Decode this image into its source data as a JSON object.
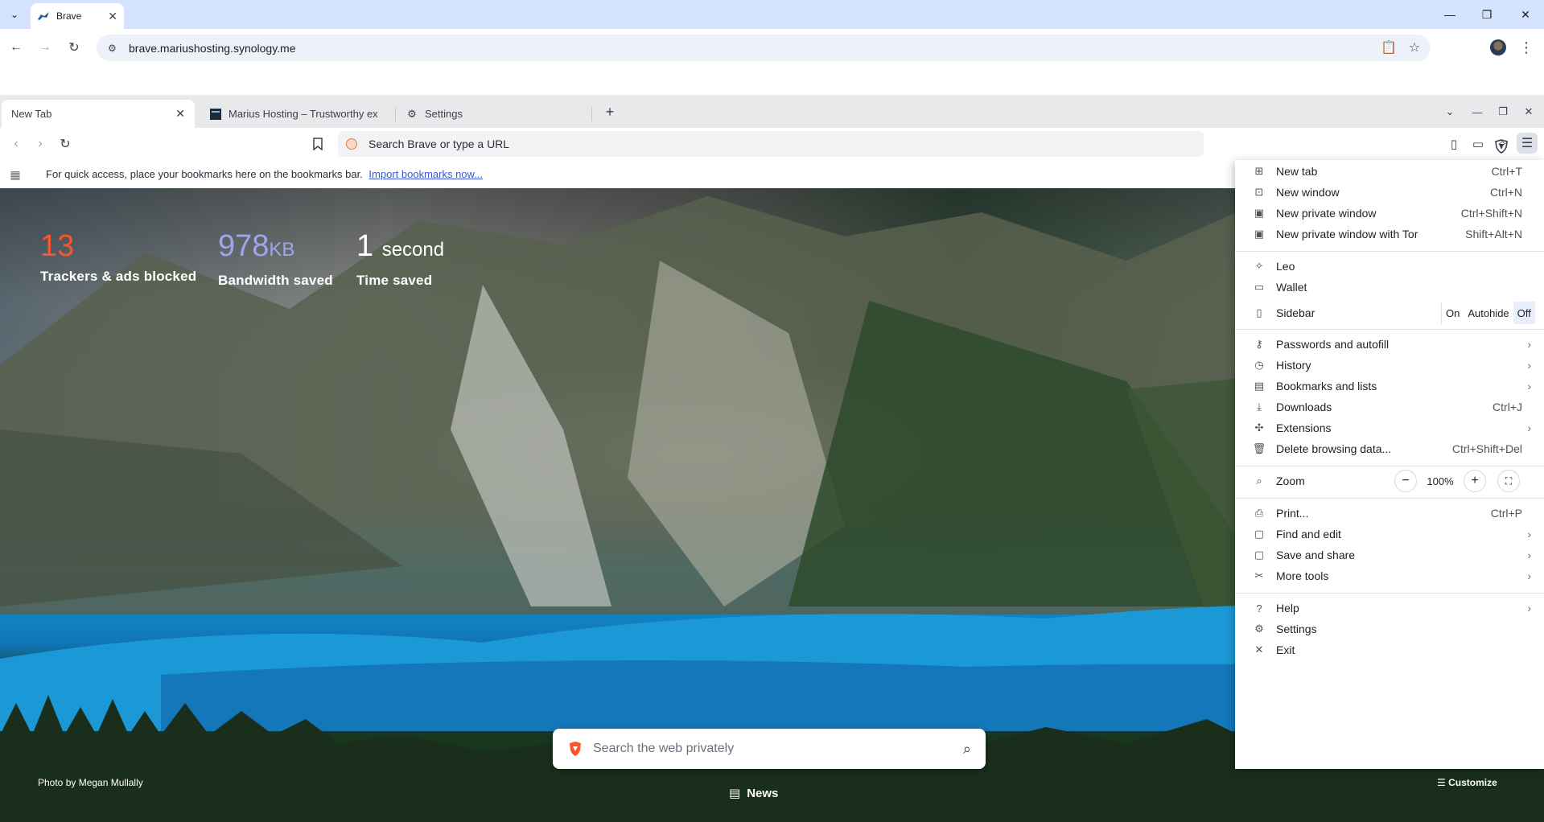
{
  "host": {
    "tab_title": "Brave",
    "url": "brave.mariushosting.synology.me"
  },
  "brave": {
    "tabs": [
      {
        "label": "New Tab",
        "active": true
      },
      {
        "label": "Marius Hosting – Trustworthy ex",
        "active": false
      },
      {
        "label": "Settings",
        "active": false
      }
    ],
    "omnibox_placeholder": "Search Brave or type a URL",
    "bookmarks_bar": {
      "message": "For quick access, place your bookmarks here on the bookmarks bar.",
      "import_link": "Import bookmarks now..."
    }
  },
  "ntp": {
    "stats": [
      {
        "value": "13",
        "unit": "",
        "label": "Trackers & ads blocked",
        "color": "#fb542b"
      },
      {
        "value": "978",
        "unit": "KB",
        "label": "Bandwidth saved",
        "color": "#a0a5eb"
      },
      {
        "value": "1",
        "unit": "second",
        "label": "Time saved",
        "color": "#ffffff"
      }
    ],
    "search_placeholder": "Search the web privately",
    "photo_credit": "Photo by Megan Mullally",
    "news_label": "News",
    "customize_label": "Customize"
  },
  "menu": {
    "items": [
      {
        "id": "new-tab",
        "label": "New tab",
        "shortcut": "Ctrl+T",
        "icon": "new-tab-icon"
      },
      {
        "id": "new-window",
        "label": "New window",
        "shortcut": "Ctrl+N",
        "icon": "new-window-icon"
      },
      {
        "id": "new-private-window",
        "label": "New private window",
        "shortcut": "Ctrl+Shift+N",
        "icon": "private-window-icon"
      },
      {
        "id": "new-private-window-tor",
        "label": "New private window with Tor",
        "shortcut": "Shift+Alt+N",
        "icon": "tor-window-icon"
      },
      {
        "id": "leo",
        "label": "Leo",
        "shortcut": "",
        "icon": "leo-icon"
      },
      {
        "id": "wallet",
        "label": "Wallet",
        "shortcut": "",
        "icon": "wallet-icon"
      },
      {
        "id": "sidebar",
        "label": "Sidebar",
        "shortcut": "",
        "icon": "sidebar-icon"
      },
      {
        "id": "passwords",
        "label": "Passwords and autofill",
        "shortcut": "",
        "icon": "key-icon",
        "submenu": true
      },
      {
        "id": "history",
        "label": "History",
        "shortcut": "",
        "icon": "history-icon",
        "submenu": true
      },
      {
        "id": "bookmarks",
        "label": "Bookmarks and lists",
        "shortcut": "",
        "icon": "bookmarks-icon",
        "submenu": true
      },
      {
        "id": "downloads",
        "label": "Downloads",
        "shortcut": "Ctrl+J",
        "icon": "download-icon"
      },
      {
        "id": "extensions",
        "label": "Extensions",
        "shortcut": "",
        "icon": "extensions-icon",
        "submenu": true
      },
      {
        "id": "delete-data",
        "label": "Delete browsing data...",
        "shortcut": "Ctrl+Shift+Del",
        "icon": "trash-icon"
      },
      {
        "id": "zoom",
        "label": "Zoom",
        "shortcut": "",
        "icon": "zoom-icon"
      },
      {
        "id": "print",
        "label": "Print...",
        "shortcut": "Ctrl+P",
        "icon": "print-icon"
      },
      {
        "id": "find-edit",
        "label": "Find and edit",
        "shortcut": "",
        "icon": "find-icon",
        "submenu": true
      },
      {
        "id": "save-share",
        "label": "Save and share",
        "shortcut": "",
        "icon": "share-icon",
        "submenu": true
      },
      {
        "id": "more-tools",
        "label": "More tools",
        "shortcut": "",
        "icon": "tools-icon",
        "submenu": true
      },
      {
        "id": "help",
        "label": "Help",
        "shortcut": "",
        "icon": "help-icon",
        "submenu": true
      },
      {
        "id": "settings",
        "label": "Settings",
        "shortcut": "",
        "icon": "gear-icon"
      },
      {
        "id": "exit",
        "label": "Exit",
        "shortcut": "",
        "icon": "close-icon"
      }
    ],
    "sidebar_options": [
      "On",
      "Autohide",
      "Off"
    ],
    "sidebar_selected": "Off",
    "zoom_value": "100%",
    "zoom_minus": "−",
    "zoom_plus": "+"
  }
}
